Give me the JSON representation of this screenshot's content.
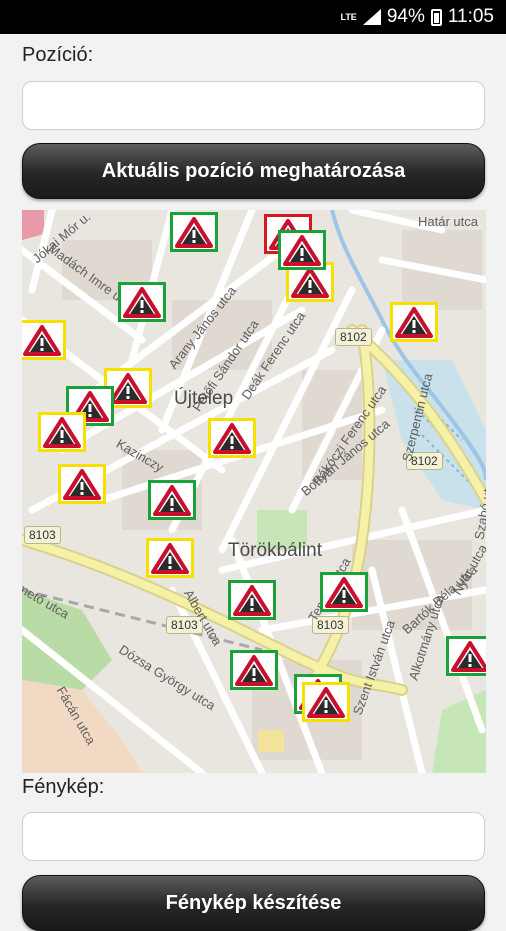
{
  "status_bar": {
    "network": "LTE",
    "battery": "94%",
    "time": "11:05"
  },
  "position": {
    "label": "Pozíció:",
    "value": "",
    "button": "Aktuális pozíció meghatározása"
  },
  "map": {
    "places": {
      "ujtelep": "Újtelep",
      "torokbalint": "Törökbálint"
    },
    "roads": [
      "8102",
      "8102",
      "8103",
      "8103",
      "8103"
    ],
    "streets": [
      "Jókai Mór u.",
      "Madách Imre utca",
      "Arany János utca",
      "Petőfi Sándor utca",
      "Deák Ferenc utca",
      "Rákóczi Ferenc utca",
      "Bottyán János utca",
      "Szerpentin utca",
      "Kazinczy",
      "Bartók Béla utca",
      "Dózsa György utca",
      "Albert utca",
      "Temető utca",
      "Nyár utca",
      "Szabó utca",
      "Alkotmány utca",
      "Fácán utca",
      "Szent István utca",
      "Határ utca",
      "Temető utca"
    ],
    "marker_icon": "warning-triangle-icon"
  },
  "photo": {
    "label": "Fénykép:",
    "value": "",
    "button": "Fénykép készítése"
  }
}
